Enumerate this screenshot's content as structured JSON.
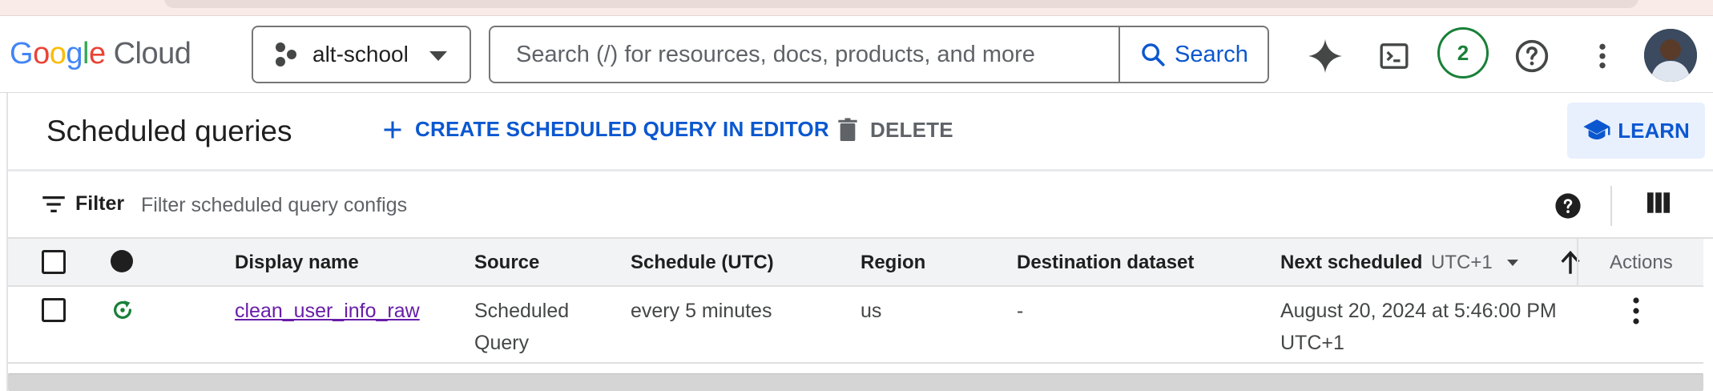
{
  "browser": {},
  "header": {
    "logo": {
      "g1": "G",
      "g2": "o",
      "g3": "o",
      "g4": "g",
      "g5": "l",
      "g6": "e",
      "product": "Cloud"
    },
    "project_picker": {
      "label": "alt-school"
    },
    "search": {
      "placeholder": "Search (/) for resources, docs, products, and more",
      "button_label": "Search"
    },
    "notifications_count": "2",
    "icons": [
      "gemini-icon",
      "cloud-shell-icon",
      "help-icon",
      "more-vert-icon"
    ]
  },
  "toolbar": {
    "title": "Scheduled queries",
    "create_label": "CREATE SCHEDULED QUERY IN EDITOR",
    "delete_label": "DELETE",
    "learn_label": "LEARN"
  },
  "filter": {
    "label": "Filter",
    "placeholder": "Filter scheduled query configs"
  },
  "table": {
    "columns": {
      "display_name": "Display name",
      "source": "Source",
      "schedule": "Schedule (UTC)",
      "region": "Region",
      "destination": "Destination dataset",
      "next_scheduled": "Next scheduled",
      "timezone": "UTC+1",
      "actions": "Actions"
    },
    "rows": [
      {
        "display_name": "clean_user_info_raw",
        "source_line1": "Scheduled",
        "source_line2": "Query",
        "schedule": "every 5 minutes",
        "region": "us",
        "destination": "-",
        "next_line1": "August 20, 2024 at 5:46:00 PM",
        "next_line2": "UTC+1",
        "status": "running"
      }
    ]
  },
  "colors": {
    "accent": "#0b57d0",
    "link_visited": "#681da8",
    "status_green": "#188038"
  }
}
